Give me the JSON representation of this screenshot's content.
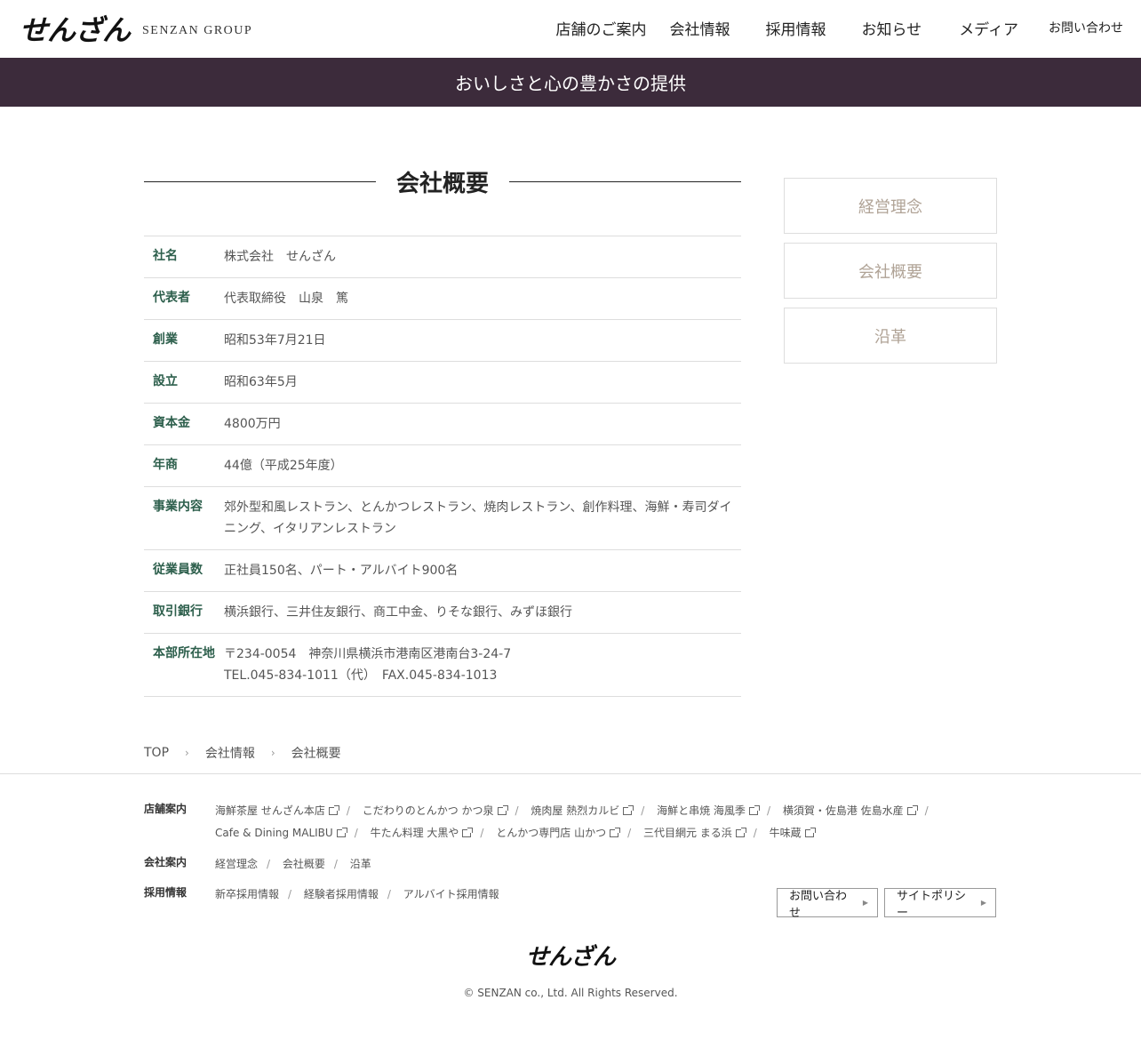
{
  "header": {
    "logo_mark": "せんざん",
    "logo_sub": "SENZAN GROUP",
    "nav": [
      "店舗のご案内",
      "会社情報",
      "採用情報",
      "お知らせ",
      "メディア",
      "お問い合わせ"
    ]
  },
  "banner": {
    "text": "おいしさと心の豊かさの提供"
  },
  "main": {
    "title": "会社概要",
    "rows": [
      {
        "label": "社名",
        "value": "株式会社　せんざん"
      },
      {
        "label": "代表者",
        "value": "代表取締役　山泉　篤"
      },
      {
        "label": "創業",
        "value": "昭和53年7月21日"
      },
      {
        "label": "設立",
        "value": "昭和63年5月"
      },
      {
        "label": "資本金",
        "value": "4800万円"
      },
      {
        "label": "年商",
        "value": "44億（平成25年度）"
      },
      {
        "label": "事業内容",
        "value": "郊外型和風レストラン、とんかつレストラン、焼肉レストラン、創作料理、海鮮・寿司ダイニング、イタリアンレストラン"
      },
      {
        "label": "従業員数",
        "value": "正社員150名、パート・アルバイト900名"
      },
      {
        "label": "取引銀行",
        "value": "横浜銀行、三井住友銀行、商工中金、りそな銀行、みずほ銀行"
      },
      {
        "label": "本部所在地",
        "value": "〒234-0054　神奈川県横浜市港南区港南台3-24-7",
        "value2": "TEL.045-834-1011（代）　FAX.045-834-1013"
      }
    ]
  },
  "sidenav": [
    "経営理念",
    "会社概要",
    "沿革"
  ],
  "breadcrumb": [
    "TOP",
    "会社情報",
    "会社概要"
  ],
  "footer": {
    "stores_label": "店舗案内",
    "stores": [
      "海鮮茶屋 せんざん本店",
      "こだわりのとんかつ かつ泉",
      "焼肉屋 熱烈カルビ",
      "海鮮と串焼 海風季",
      "横須賀・佐島港 佐島水産",
      "Cafe & Dining MALIBU",
      "牛たん料理 大黒や",
      "とんかつ専門店 山かつ",
      "三代目網元 まる浜",
      "牛味蔵"
    ],
    "company_label": "会社案内",
    "company": [
      "経営理念",
      "会社概要",
      "沿革"
    ],
    "recruit_label": "採用情報",
    "recruit": [
      "新卒採用情報",
      "経験者採用情報",
      "アルバイト採用情報"
    ],
    "contact_button": "お問い合わせ",
    "policy_button": "サイトポリシー",
    "logo": "せんざん",
    "copyright": "© SENZAN co., Ltd. All Rights Reserved."
  }
}
